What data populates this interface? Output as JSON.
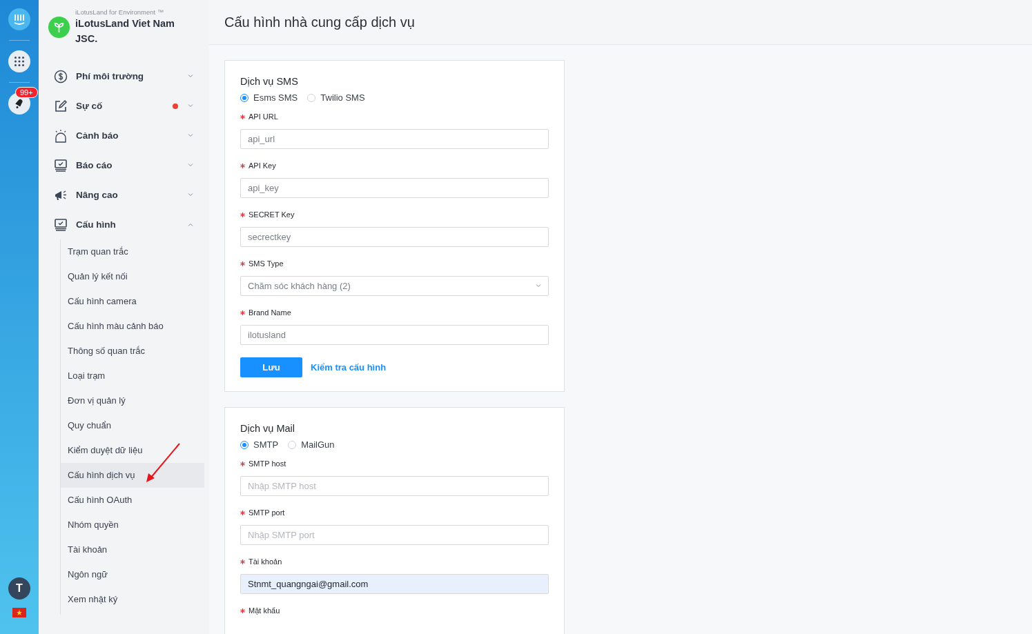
{
  "rail": {
    "badge": "99+",
    "avatar": "T"
  },
  "brand": {
    "tagline": "iLotusLand for Environment ™",
    "name": "iLotusLand Viet Nam JSC."
  },
  "menu": [
    {
      "label": "Phí môi trường",
      "kind": "dollar",
      "expanded": false,
      "alert": false
    },
    {
      "label": "Sự cố",
      "kind": "edit",
      "expanded": false,
      "alert": true
    },
    {
      "label": "Cảnh báo",
      "kind": "siren",
      "expanded": false,
      "alert": false
    },
    {
      "label": "Báo cáo",
      "kind": "monitor",
      "expanded": false,
      "alert": false
    },
    {
      "label": "Nâng cao",
      "kind": "megaphone",
      "expanded": false,
      "alert": false
    },
    {
      "label": "Cấu hình",
      "kind": "monitor",
      "expanded": true,
      "alert": false,
      "children": [
        {
          "label": "Trạm quan trắc",
          "selected": false
        },
        {
          "label": "Quản lý kết nối",
          "selected": false
        },
        {
          "label": "Cấu hình camera",
          "selected": false
        },
        {
          "label": "Cấu hình màu cảnh báo",
          "selected": false
        },
        {
          "label": "Thông số quan trắc",
          "selected": false
        },
        {
          "label": "Loại trạm",
          "selected": false
        },
        {
          "label": "Đơn vị quản lý",
          "selected": false
        },
        {
          "label": "Quy chuẩn",
          "selected": false
        },
        {
          "label": "Kiểm duyệt dữ liệu",
          "selected": false
        },
        {
          "label": "Cấu hình dịch vụ",
          "selected": true
        },
        {
          "label": "Cấu hình OAuth",
          "selected": false
        },
        {
          "label": "Nhóm quyền",
          "selected": false
        },
        {
          "label": "Tài khoản",
          "selected": false
        },
        {
          "label": "Ngôn ngữ",
          "selected": false
        },
        {
          "label": "Xem nhật ký",
          "selected": false
        }
      ]
    }
  ],
  "page_title": "Cấu hình nhà cung cấp dịch vụ",
  "cards": [
    {
      "title": "Dịch vụ SMS",
      "options": [
        {
          "label": "Esms SMS",
          "selected": true
        },
        {
          "label": "Twilio SMS",
          "selected": false
        }
      ],
      "fields": [
        {
          "label": "API URL",
          "kind": "input",
          "value": "api_url",
          "required": true
        },
        {
          "label": "API Key",
          "kind": "input",
          "value": "api_key",
          "required": true
        },
        {
          "label": "SECRET Key",
          "kind": "input",
          "value": "secrectkey",
          "required": true
        },
        {
          "label": "SMS Type",
          "kind": "select",
          "value": "Chăm sóc khách hàng (2)",
          "required": true
        },
        {
          "label": "Brand Name",
          "kind": "input",
          "value": "ilotusland",
          "required": true
        }
      ],
      "save": "Lưu",
      "test_link": "Kiểm tra cấu hình"
    },
    {
      "title": "Dịch vụ Mail",
      "options": [
        {
          "label": "SMTP",
          "selected": true
        },
        {
          "label": "MailGun",
          "selected": false
        }
      ],
      "fields": [
        {
          "label": "SMTP host",
          "kind": "input",
          "placeholder": "Nhập SMTP host",
          "required": true
        },
        {
          "label": "SMTP port",
          "kind": "input",
          "placeholder": "Nhập SMTP port",
          "required": true
        },
        {
          "label": "Tài khoản",
          "kind": "input",
          "value": "Stnmt_quangngai@gmail.com",
          "autofilled": true,
          "required": true
        },
        {
          "label": "Mật khẩu",
          "kind": "label-only",
          "required": true
        }
      ]
    }
  ]
}
